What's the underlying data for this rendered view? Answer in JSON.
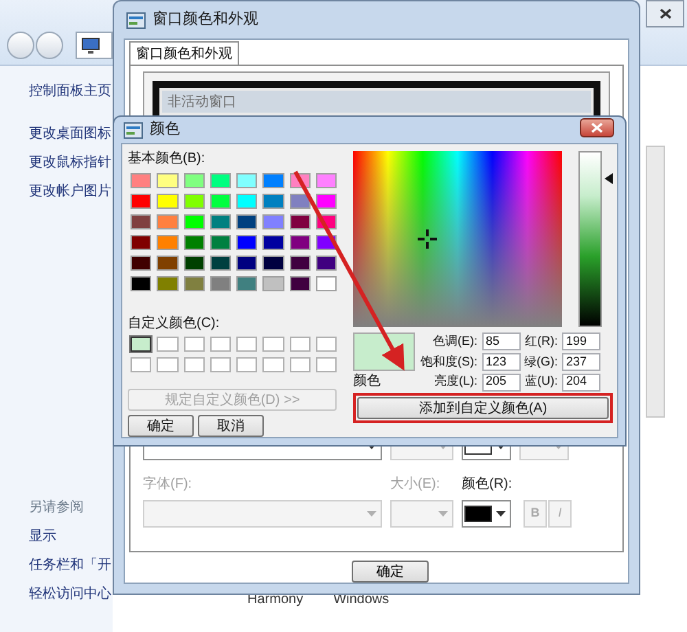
{
  "control_panel": {
    "sidebar_links": [
      "控制面板主页",
      "更改桌面图标",
      "更改鼠标指针",
      "更改帐户图片"
    ],
    "see_also_title": "另请参阅",
    "see_also_links": [
      "显示",
      "任务栏和「开",
      "轻松访问中心"
    ],
    "theme_names": [
      "Harmony",
      "Windows"
    ]
  },
  "appearance_window": {
    "title": "窗口颜色和外观",
    "tabs": [
      {
        "label": "窗口颜色和外观",
        "selected": true
      }
    ],
    "preview_title": "非活动窗口",
    "font_label": {
      "text": "字体(F):",
      "disabled": true
    },
    "size_label": {
      "text": "大小(E):",
      "disabled": true
    },
    "color_label": {
      "text": "颜色(R):",
      "disabled": false
    },
    "bold_button": {
      "text": "B",
      "disabled": true
    },
    "italic_button": {
      "text": "I",
      "disabled": true
    },
    "ok_button": "确定"
  },
  "color_dialog": {
    "title": "颜色",
    "basic_label": "基本颜色(B):",
    "basic_colors": [
      {
        "color": "#ff8080"
      },
      {
        "color": "#ffff80"
      },
      {
        "color": "#80ff80"
      },
      {
        "color": "#00ff80"
      },
      {
        "color": "#80ffff"
      },
      {
        "color": "#0080ff"
      },
      {
        "color": "#ff80c0"
      },
      {
        "color": "#ff80ff"
      },
      {
        "color": "#ff0000"
      },
      {
        "color": "#ffff00"
      },
      {
        "color": "#80ff00"
      },
      {
        "color": "#00ff40"
      },
      {
        "color": "#00ffff"
      },
      {
        "color": "#0080c0"
      },
      {
        "color": "#8080c0"
      },
      {
        "color": "#ff00ff"
      },
      {
        "color": "#804040"
      },
      {
        "color": "#ff8040"
      },
      {
        "color": "#00ff00"
      },
      {
        "color": "#008080"
      },
      {
        "color": "#004080"
      },
      {
        "color": "#8080ff"
      },
      {
        "color": "#800040"
      },
      {
        "color": "#ff0080"
      },
      {
        "color": "#800000"
      },
      {
        "color": "#ff8000"
      },
      {
        "color": "#008000"
      },
      {
        "color": "#008040"
      },
      {
        "color": "#0000ff"
      },
      {
        "color": "#0000a0"
      },
      {
        "color": "#800080"
      },
      {
        "color": "#8000ff"
      },
      {
        "color": "#400000"
      },
      {
        "color": "#804000"
      },
      {
        "color": "#004000"
      },
      {
        "color": "#004040"
      },
      {
        "color": "#000080"
      },
      {
        "color": "#000040"
      },
      {
        "color": "#400040"
      },
      {
        "color": "#400080"
      },
      {
        "color": "#000000"
      },
      {
        "color": "#808000"
      },
      {
        "color": "#808040"
      },
      {
        "color": "#808080"
      },
      {
        "color": "#408080"
      },
      {
        "color": "#c0c0c0"
      },
      {
        "color": "#400040"
      },
      {
        "color": "#ffffff"
      }
    ],
    "custom_label": "自定义颜色(C):",
    "custom_colors": [
      {
        "color": "#c7edcc",
        "selected": true
      },
      {
        "color": "#ffffff",
        "selected": false
      },
      {
        "color": "#ffffff",
        "selected": false
      },
      {
        "color": "#ffffff",
        "selected": false
      },
      {
        "color": "#ffffff",
        "selected": false
      },
      {
        "color": "#ffffff",
        "selected": false
      },
      {
        "color": "#ffffff",
        "selected": false
      },
      {
        "color": "#ffffff",
        "selected": false
      },
      {
        "color": "#ffffff",
        "selected": false
      },
      {
        "color": "#ffffff",
        "selected": false
      },
      {
        "color": "#ffffff",
        "selected": false
      },
      {
        "color": "#ffffff",
        "selected": false
      },
      {
        "color": "#ffffff",
        "selected": false
      },
      {
        "color": "#ffffff",
        "selected": false
      },
      {
        "color": "#ffffff",
        "selected": false
      },
      {
        "color": "#ffffff",
        "selected": false
      }
    ],
    "define_button": {
      "text": "规定自定义颜色(D) >>",
      "disabled": true
    },
    "ok_button": "确定",
    "cancel_button": "取消",
    "preview_label": "颜色",
    "fields": [
      {
        "label": "色调(E):",
        "value": "85"
      },
      {
        "label": "红(R):",
        "value": "199"
      },
      {
        "label": "饱和度(S):",
        "value": "123"
      },
      {
        "label": "绿(G):",
        "value": "237"
      },
      {
        "label": "亮度(L):",
        "value": "205"
      },
      {
        "label": "蓝(U):",
        "value": "204"
      }
    ],
    "add_button": {
      "text": "添加到自定义颜色(A)",
      "highlighted": true
    }
  }
}
